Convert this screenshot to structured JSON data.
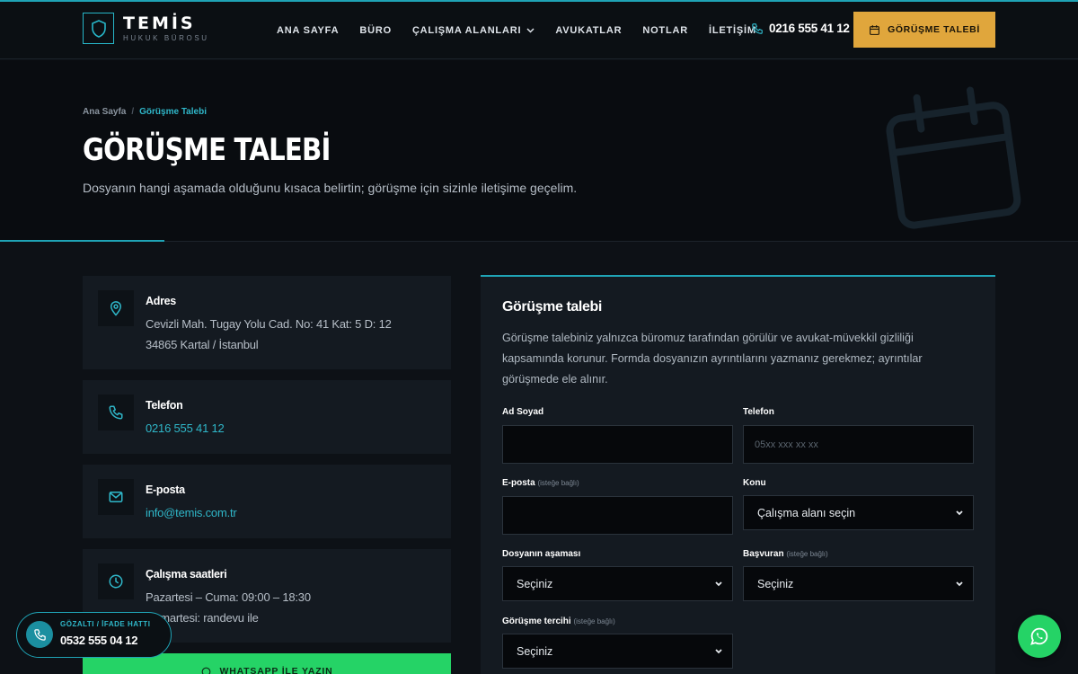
{
  "brand": {
    "name": "TEMİS",
    "tagline": "HUKUK BÜROSU"
  },
  "nav": {
    "items": [
      {
        "label": "ANA SAYFA"
      },
      {
        "label": "BÜRO"
      },
      {
        "label": "ÇALIŞMA ALANLARI"
      },
      {
        "label": "AVUKATLAR"
      },
      {
        "label": "NOTLAR"
      },
      {
        "label": "İLETİŞİM"
      }
    ],
    "phone": "0216 555 41 12",
    "cta_label": "GÖRÜŞME TALEBİ"
  },
  "hero": {
    "breadcrumb": {
      "home": "Ana Sayfa",
      "separator": "/",
      "current": "Görüşme Talebi"
    },
    "title": "GÖRÜŞME TALEBİ",
    "description": "Dosyanın hangi aşamada olduğunu kısaca belirtin; görüşme için sizinle iletişime geçelim."
  },
  "contact": {
    "address": {
      "title": "Adres",
      "line1": "Cevizli Mah. Tugay Yolu Cad. No: 41 Kat: 5 D: 12",
      "line2": "34865 Kartal / İstanbul"
    },
    "phone": {
      "title": "Telefon",
      "value": "0216 555 41 12"
    },
    "email": {
      "title": "E-posta",
      "value": "info@temis.com.tr"
    },
    "hours": {
      "title": "Çalışma saatleri",
      "line1": "Pazartesi – Cuma: 09:00 – 18:30",
      "line2": "Cumartesi: randevu ile"
    },
    "whatsapp_label": "WHATSAPP İLE YAZIN"
  },
  "form": {
    "title": "Görüşme talebi",
    "description": "Görüşme talebiniz yalnızca büromuz tarafından görülür ve avukat-müvekkil gizliliği kapsamında korunur. Formda dosyanızın ayrıntılarını yazmanız gerekmez; ayrıntılar görüşmede ele alınır.",
    "optional_tag": "(isteğe bağlı)",
    "name_label": "Ad Soyad",
    "phone_label": "Telefon",
    "phone_placeholder": "05xx xxx xx xx",
    "email_label": "E-posta",
    "topic_label": "Konu",
    "topic_value": "Çalışma alanı seçin",
    "stage_label": "Dosyanın aşaması",
    "stage_value": "Seçiniz",
    "applicant_label": "Başvuran",
    "applicant_value": "Seçiniz",
    "preference_label": "Görüşme tercihi",
    "preference_value": "Seçiniz"
  },
  "hotline": {
    "label": "GÖZALTI / İFADE HATTI",
    "number": "0532 555 04 12"
  },
  "colors": {
    "accent": "#1fa3b5",
    "cta": "#e0a63c",
    "whatsapp": "#25d366",
    "background": "#0d1116",
    "card": "#141a21"
  }
}
